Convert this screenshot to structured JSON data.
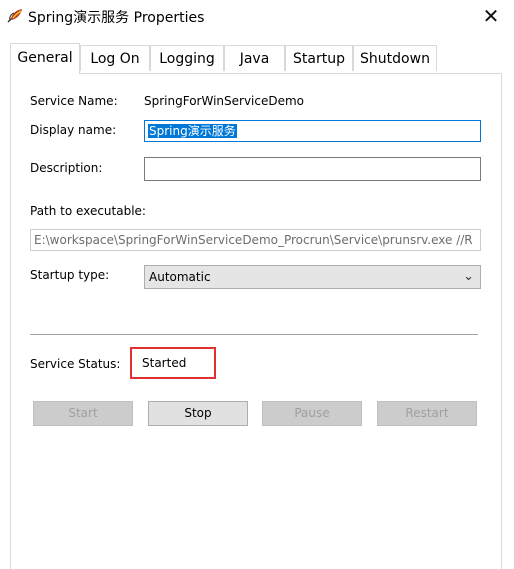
{
  "window": {
    "title": "Spring演示服务 Properties",
    "close_glyph": "✕"
  },
  "tabs": [
    {
      "label": "General",
      "active": true
    },
    {
      "label": "Log On"
    },
    {
      "label": "Logging"
    },
    {
      "label": "Java"
    },
    {
      "label": "Startup"
    },
    {
      "label": "Shutdown"
    }
  ],
  "general": {
    "service_name_label": "Service Name:",
    "service_name_value": "SpringForWinServiceDemo",
    "display_name_label": "Display name:",
    "display_name_value": "Spring演示服务",
    "description_label": "Description:",
    "description_value": "",
    "path_label": "Path to executable:",
    "path_value": "E:\\workspace\\SpringForWinServiceDemo_Procrun\\Service\\prunsrv.exe //R",
    "startup_type_label": "Startup type:",
    "startup_type_value": "Automatic",
    "service_status_label": "Service Status:",
    "service_status_value": "Started"
  },
  "buttons": {
    "start": "Start",
    "stop": "Stop",
    "pause": "Pause",
    "restart": "Restart"
  },
  "colors": {
    "selection": "#0078d7",
    "highlight_box": "#e03030"
  }
}
